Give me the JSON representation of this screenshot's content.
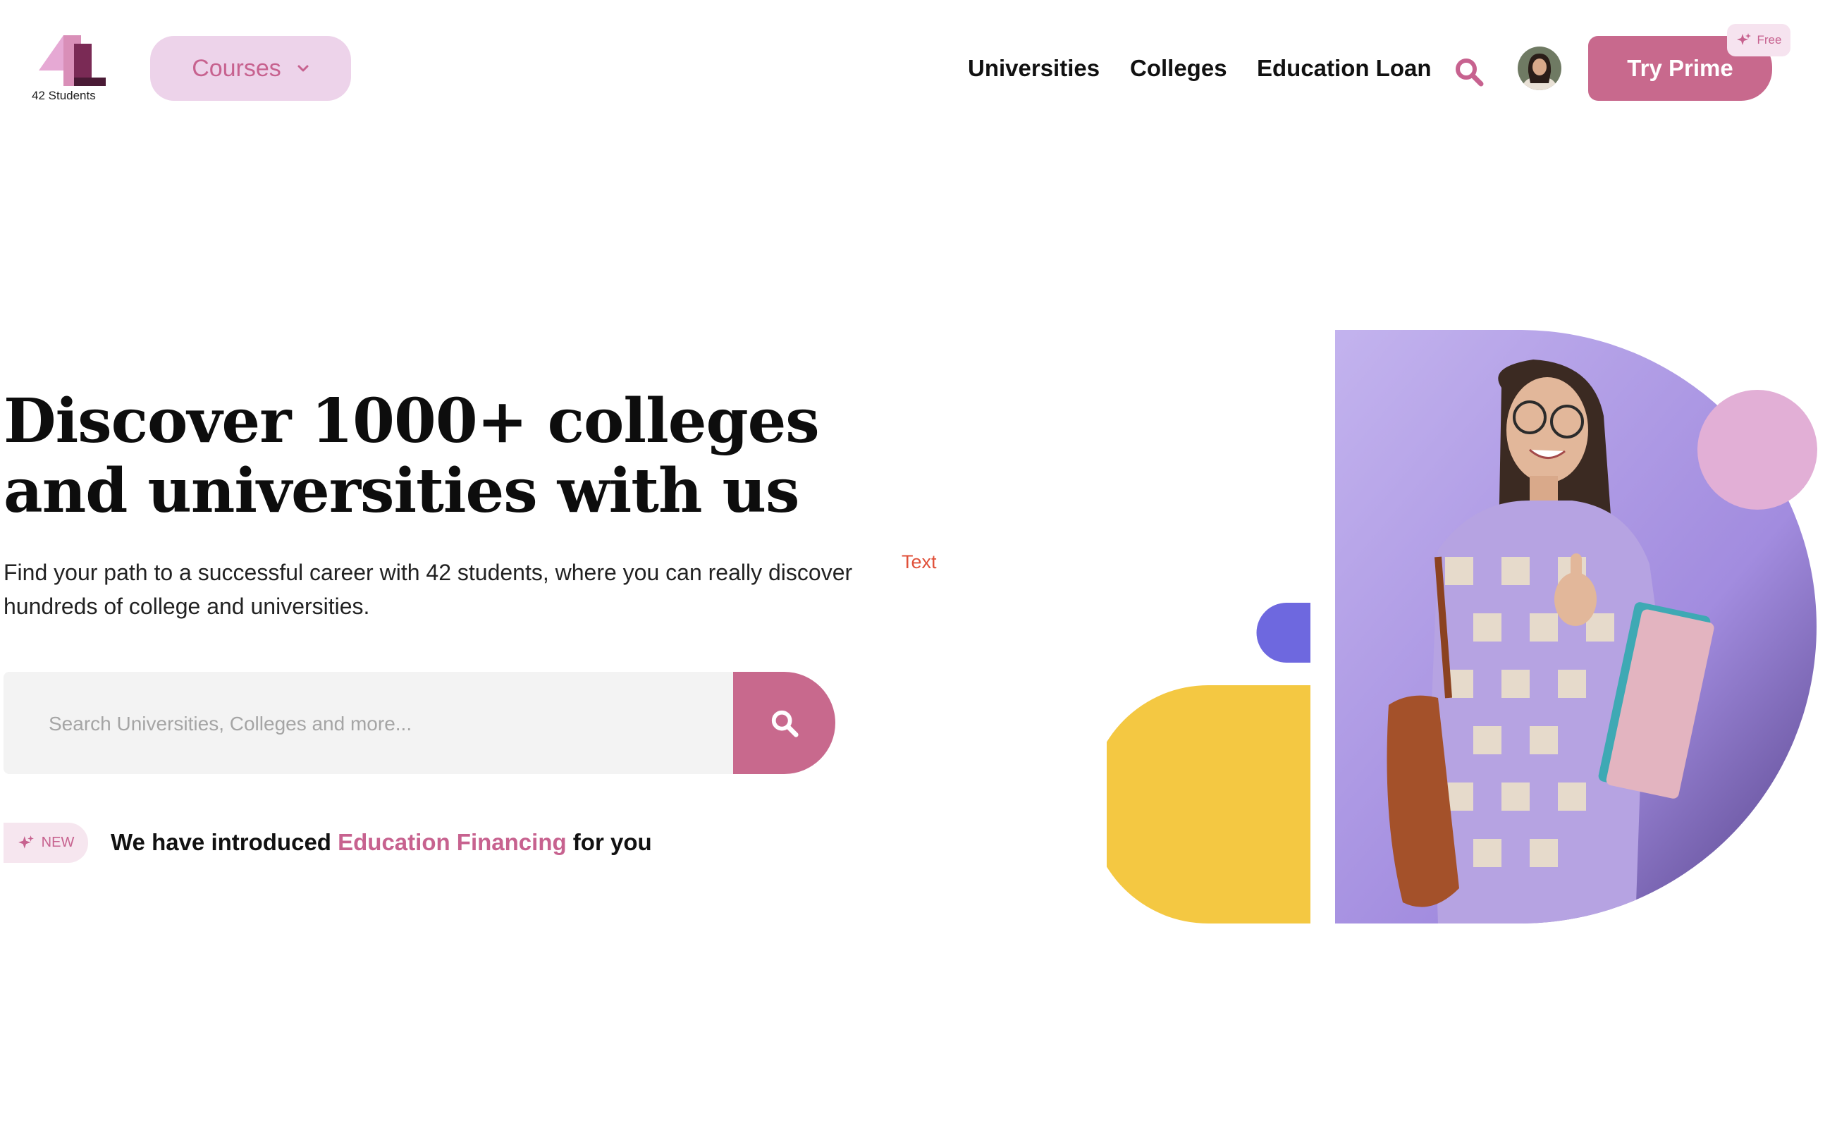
{
  "brand": {
    "name": "42 Students"
  },
  "header": {
    "courses_label": "Courses",
    "nav": [
      "Universities",
      "Colleges",
      "Education Loan"
    ],
    "cta_label": "Try Prime",
    "cta_badge": "Free"
  },
  "hero": {
    "title": "Discover 1000+ colleges and universities with us",
    "subtitle": "Find your path to a successful career with 42 students, where you can really discover hundreds of college and universities.",
    "stray_label": "Text",
    "search_placeholder": "Search Universities, Colleges and more...",
    "new_badge": "NEW",
    "announce_prefix": "We have introduced ",
    "announce_link": "Education Financing",
    "announce_suffix": " for you"
  },
  "colors": {
    "accent": "#c8698d",
    "accent_light": "#edd3ea",
    "yellow": "#f4c842",
    "indigo": "#6e68df",
    "lavender": "#b9a6e6"
  },
  "icons": [
    "logo-icon",
    "chevron-down-icon",
    "search-icon",
    "sparkle-icon"
  ]
}
